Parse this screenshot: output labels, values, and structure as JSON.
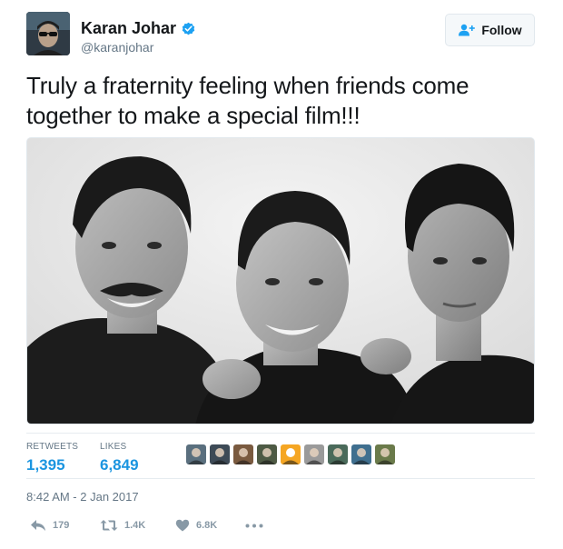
{
  "user": {
    "display_name": "Karan Johar",
    "handle": "@karanjohar",
    "verified": true
  },
  "follow_button": {
    "label": "Follow",
    "icon": "add-person-icon"
  },
  "tweet": {
    "text": "Truly a fraternity feeling when friends come together to make a special film!!!",
    "timestamp": "8:42 AM - 2 Jan 2017"
  },
  "stats": {
    "retweets_label": "RETWEETS",
    "retweets_value": "1,395",
    "likes_label": "LIKES",
    "likes_value": "6,849"
  },
  "likers": [
    {
      "color": "#5a6f7e"
    },
    {
      "color": "#3d4a56"
    },
    {
      "color": "#7a5a3f"
    },
    {
      "color": "#4e5a44"
    },
    {
      "color": "#f5a623"
    },
    {
      "color": "#9a9a9a"
    },
    {
      "color": "#4a6a5a"
    },
    {
      "color": "#3f6f8f"
    },
    {
      "color": "#6a7a4a"
    }
  ],
  "actions": {
    "reply_count": "179",
    "retweet_count": "1.4K",
    "like_count": "6.8K"
  },
  "colors": {
    "accent": "#1b95e0",
    "verified": "#1da1f2",
    "muted": "#657786",
    "action": "#8899a6"
  }
}
